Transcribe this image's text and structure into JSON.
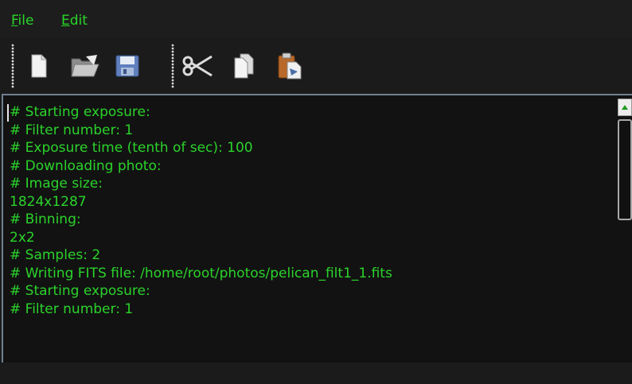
{
  "menu": {
    "file": {
      "accel": "F",
      "rest": "ile"
    },
    "edit": {
      "accel": "E",
      "rest": "dit"
    }
  },
  "toolbar": {
    "tools": [
      "new-file-icon",
      "open-folder-icon",
      "save-icon",
      "cut-icon",
      "copy-icon",
      "paste-icon"
    ]
  },
  "log": {
    "lines": [
      "# Starting exposure:",
      "# Filter number: 1",
      "# Exposure time (tenth of sec): 100",
      "# Downloading photo:",
      "# Image size:",
      "1824x1287",
      "# Binning:",
      "2x2",
      "# Samples: 2",
      "# Writing FITS file: /home/root/photos/pelican_filt1_1.fits",
      "# Starting exposure:",
      "# Filter number: 1"
    ]
  },
  "colors": {
    "text": "#2bd32b",
    "background": "#121212",
    "window": "#1b1b1b"
  }
}
